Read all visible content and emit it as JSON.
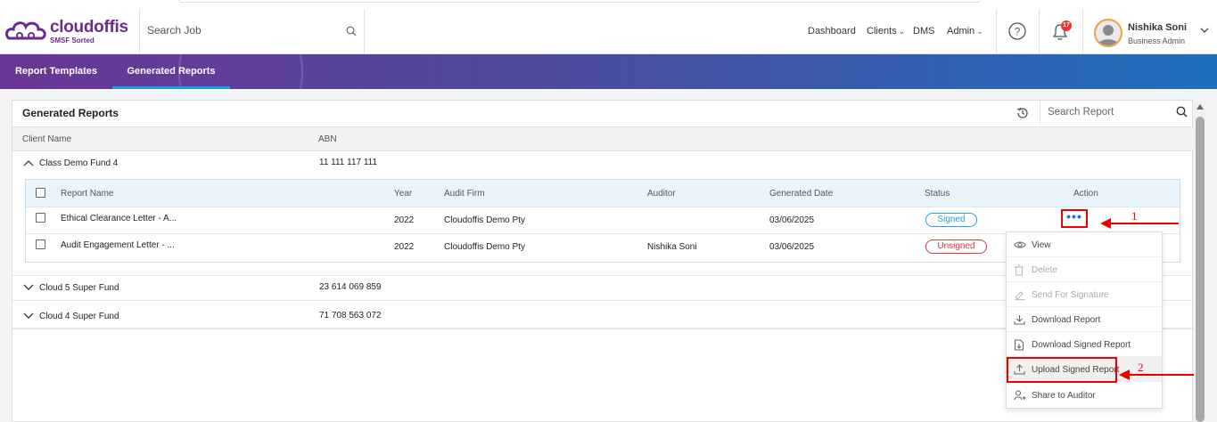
{
  "header": {
    "brand_name": "cloudoffis",
    "brand_tagline": "SMSF Sorted",
    "search_placeholder": "Search Job",
    "nav": {
      "dashboard": "Dashboard",
      "clients": "Clients",
      "dms": "DMS",
      "admin": "Admin"
    },
    "notification_count": "17",
    "user_name": "Nishika Soni",
    "user_role": "Business Admin"
  },
  "tabs": [
    {
      "label": "Report Templates",
      "active": false
    },
    {
      "label": "Generated Reports",
      "active": true
    }
  ],
  "panel": {
    "title": "Generated Reports",
    "search_placeholder": "Search Report",
    "columns": {
      "client_name": "Client Name",
      "abn": "ABN"
    },
    "groups": [
      {
        "name": "Class Demo Fund 4",
        "abn": "11 111 117 111",
        "expanded": true
      },
      {
        "name": "Cloud 5 Super Fund",
        "abn": "23 614 069 859",
        "expanded": false
      },
      {
        "name": "Cloud 4 Super Fund",
        "abn": "71 708 563 072",
        "expanded": false
      }
    ],
    "report_columns": {
      "report_name": "Report Name",
      "year": "Year",
      "audit_firm": "Audit Firm",
      "auditor": "Auditor",
      "generated_date": "Generated Date",
      "status": "Status",
      "action": "Action"
    },
    "reports": [
      {
        "name": "Ethical Clearance Letter - A...",
        "year": "2022",
        "audit_firm": "Cloudoffis Demo Pty",
        "auditor": "",
        "generated_date": "03/06/2025",
        "status": "Signed"
      },
      {
        "name": "Audit Engagement Letter - ...",
        "year": "2022",
        "audit_firm": "Cloudoffis Demo Pty",
        "auditor": "Nishika Soni",
        "generated_date": "03/06/2025",
        "status": "Unsigned"
      }
    ]
  },
  "action_menu": {
    "items": [
      {
        "label": "View",
        "icon": "eye-icon",
        "disabled": false
      },
      {
        "label": "Delete",
        "icon": "trash-icon",
        "disabled": true
      },
      {
        "label": "Send For Signature",
        "icon": "signature-icon",
        "disabled": true
      },
      {
        "label": "Download Report",
        "icon": "download-icon",
        "disabled": false
      },
      {
        "label": "Download Signed Report",
        "icon": "file-download-icon",
        "disabled": false
      },
      {
        "label": "Upload Signed Report",
        "icon": "upload-icon",
        "disabled": false
      },
      {
        "label": "Share to Auditor",
        "icon": "share-user-icon",
        "disabled": false
      }
    ]
  },
  "annotations": {
    "step1": "1",
    "step2": "2"
  },
  "colors": {
    "brand_purple": "#6b2a8e",
    "band_start": "#6a3596",
    "band_end": "#1e6fbe",
    "signed": "#2a9fd0",
    "unsigned": "#d9363e",
    "annotation_red": "#e00000"
  }
}
